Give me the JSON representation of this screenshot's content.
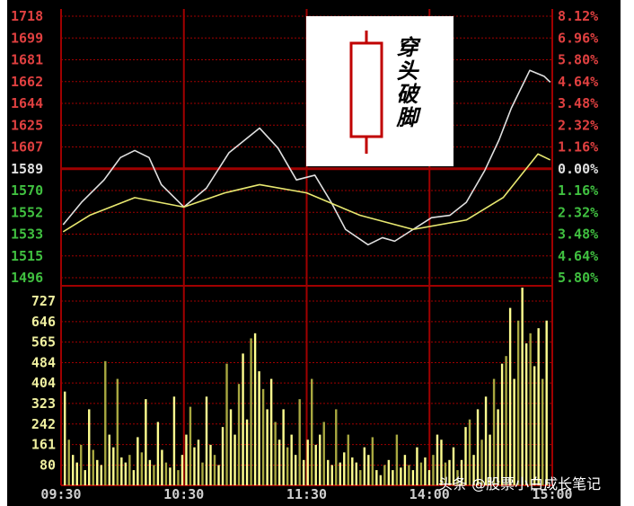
{
  "chart_data": {
    "type": "line",
    "title": "",
    "price_axis_labels": [
      "1718",
      "1699",
      "1681",
      "1662",
      "1644",
      "1625",
      "1607",
      "1589",
      "1570",
      "1552",
      "1533",
      "1515",
      "1496"
    ],
    "percent_axis_labels": [
      "8.12%",
      "6.96%",
      "5.80%",
      "4.64%",
      "3.48%",
      "2.32%",
      "1.16%",
      "0.00%",
      "1.16%",
      "2.32%",
      "3.48%",
      "4.64%",
      "5.80%"
    ],
    "volume_axis_labels": [
      "727",
      "646",
      "565",
      "484",
      "404",
      "323",
      "242",
      "161",
      "80"
    ],
    "time_labels": [
      "09:30",
      "10:30",
      "11:30",
      "14:00",
      "15:00"
    ],
    "price_range": [
      1496,
      1718
    ],
    "prev_close": 1589,
    "volume_range": [
      0,
      727
    ],
    "minutes_range": [
      0,
      240
    ],
    "series": [
      {
        "name": "price",
        "color": "#e0e0e0",
        "t": [
          1,
          10,
          21,
          29,
          36,
          43,
          49,
          60,
          71,
          82,
          97,
          106,
          115,
          124,
          132,
          139,
          150,
          157,
          163,
          172,
          181,
          190,
          198,
          207,
          214,
          220,
          229,
          236,
          239
        ],
        "values": [
          1541,
          1560,
          1579,
          1598,
          1604,
          1598,
          1575,
          1556,
          1572,
          1602,
          1623,
          1606,
          1579,
          1583,
          1560,
          1537,
          1524,
          1530,
          1527,
          1537,
          1547,
          1549,
          1560,
          1587,
          1613,
          1640,
          1672,
          1667,
          1662
        ]
      },
      {
        "name": "average",
        "color": "#e8e870",
        "t": [
          1,
          14,
          36,
          60,
          80,
          97,
          120,
          146,
          172,
          198,
          216,
          233,
          239
        ],
        "values": [
          1535,
          1549,
          1564,
          1556,
          1568,
          1575,
          1568,
          1549,
          1537,
          1545,
          1564,
          1601,
          1596
        ]
      }
    ],
    "volume": [
      370,
      180,
      120,
      90,
      160,
      60,
      300,
      140,
      100,
      80,
      490,
      200,
      150,
      420,
      110,
      90,
      120,
      60,
      190,
      130,
      340,
      100,
      80,
      250,
      140,
      90,
      70,
      350,
      60,
      120,
      200,
      310,
      150,
      180,
      90,
      350,
      160,
      120,
      80,
      230,
      480,
      300,
      200,
      400,
      520,
      260,
      580,
      600,
      450,
      380,
      300,
      420,
      250,
      180,
      300,
      150,
      200,
      120,
      340,
      100,
      180,
      420,
      160,
      200,
      250,
      100,
      80,
      300,
      90,
      130,
      200,
      110,
      90,
      60,
      150,
      120,
      190,
      60,
      40,
      80,
      100,
      60,
      200,
      70,
      120,
      80,
      60,
      150,
      90,
      110,
      60,
      120,
      200,
      180,
      90,
      100,
      150,
      60,
      100,
      230,
      260,
      120,
      300,
      180,
      350,
      200,
      420,
      300,
      480,
      510,
      700,
      420,
      650,
      780,
      560,
      600,
      470,
      620,
      420,
      650
    ],
    "colors": {
      "up": "#e04040",
      "down": "#40c040",
      "flat": "#e0e0e0",
      "volume_a": "#ffff90",
      "volume_b": "#a8a840",
      "grid": "#a00000",
      "volume_label": "#f0f0a0"
    },
    "annotation": "穿头破脚"
  },
  "watermark": "头条 @股票小白成长笔记"
}
